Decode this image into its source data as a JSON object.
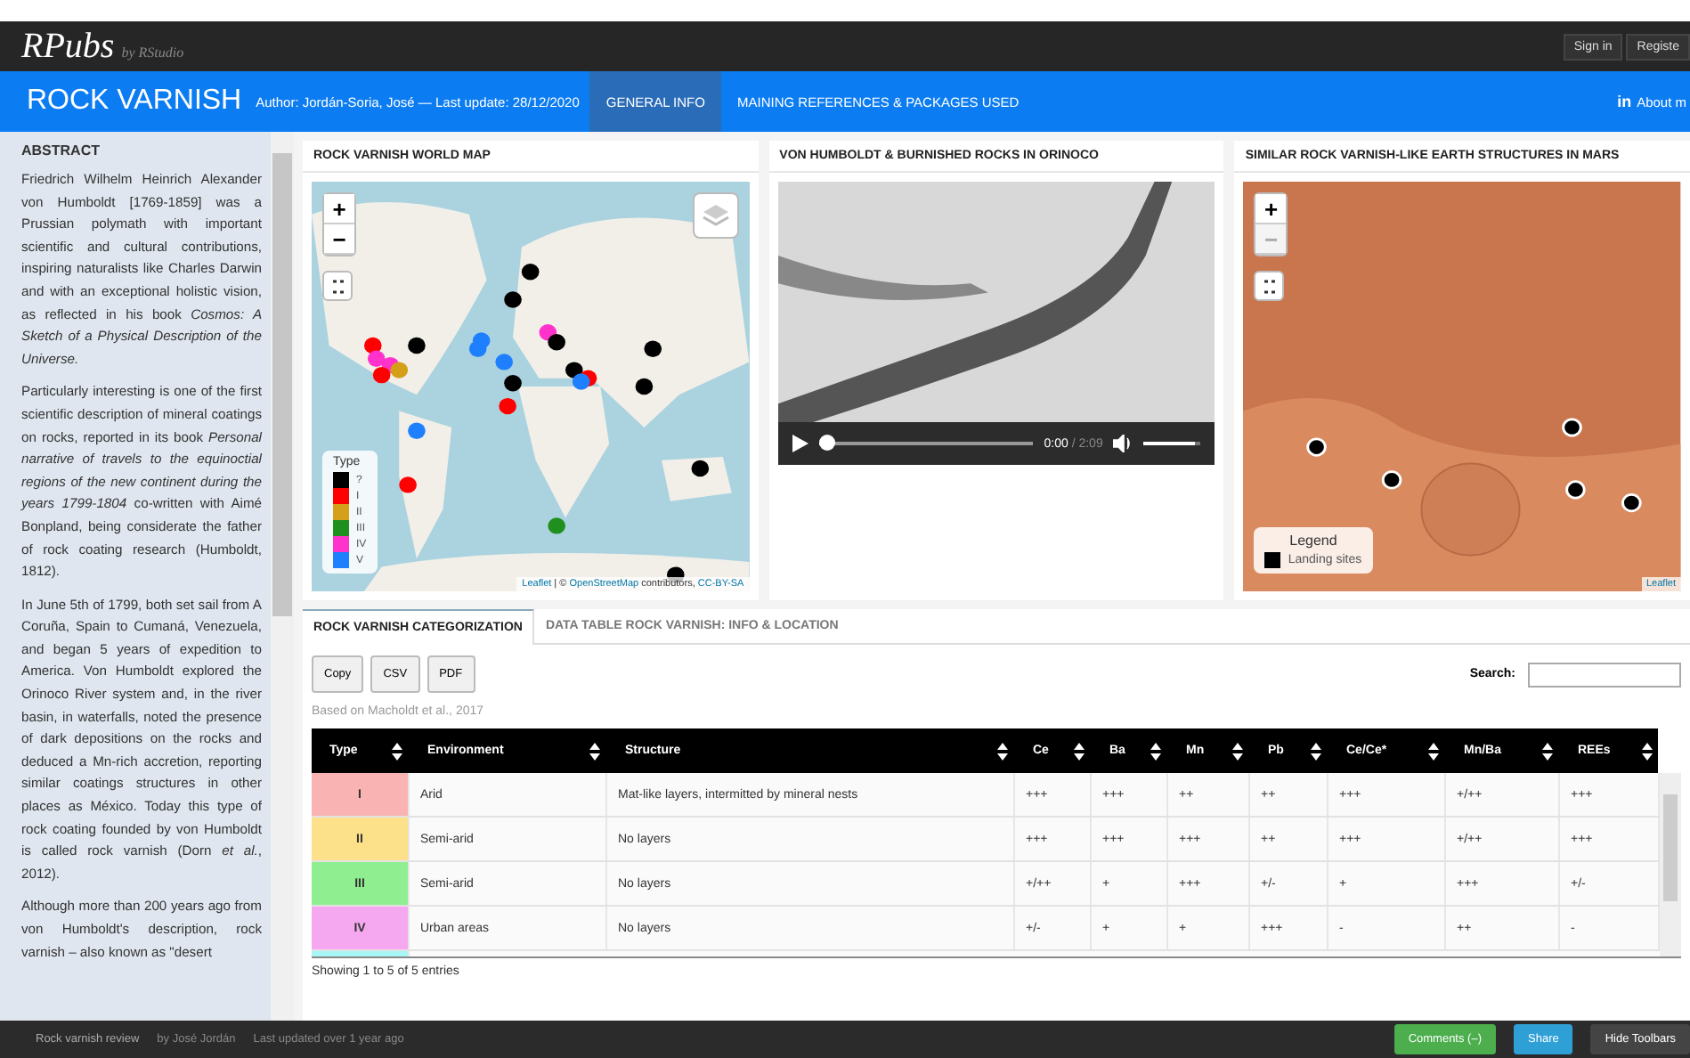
{
  "topbar": {
    "logo_main": "RPubs",
    "logo_sub": "by RStudio",
    "buttons": [
      "Sign in",
      "Registe"
    ]
  },
  "navbar": {
    "title": "ROCK VARNISH",
    "meta": "Author: Jordán-Soria, José — Last update: 28/12/2020",
    "links": [
      {
        "label": "GENERAL INFO",
        "selected": true
      },
      {
        "label": "MAINING REFERENCES & PACKAGES USED",
        "selected": false
      }
    ],
    "right_icon": "in",
    "right_link": "About m"
  },
  "sidebar": {
    "heading": "ABSTRACT",
    "paragraphs": [
      "Friedrich Wilhelm Heinrich Alexander von Humboldt [1769-1859] was a Prussian polymath with important scientific and cultural contributions, inspiring naturalists like Charles Darwin and with an exceptional holistic vision, as reflected in his book *Cosmos: A Sketch of a Physical Description of the Universe.*",
      "Particularly interesting is one of the first scientific description of mineral coatings on rocks, reported in its book *Personal narrative of travels to the equinoctial regions of the new continent during the years 1799-1804* co-written with Aimé Bonpland, being considerate the father of rock coating research (Humboldt, 1812).",
      "In June 5th of 1799, both set sail from A Coruña, Spain to Cumaná, Venezuela, and began 5 years of expedition to America. Von Humboldt explored the Orinoco River system and, in the river basin, in waterfalls, noted the presence of dark depositions on the rocks and deduced a Mn-rich accretion, reporting similar coatings structures in other places as México. Today this type of rock coating founded by von Humboldt is called rock varnish (Dorn *et al.*, 2012).",
      "Although more than 200 years ago from von Humboldt's description, rock varnish – also known as \"desert"
    ]
  },
  "panels": [
    {
      "kind": "worldmap",
      "title": "ROCK VARNISH WORLD MAP",
      "zoom_in": "+",
      "zoom_out": "−",
      "legend_title": "Type",
      "legend": [
        {
          "label": "?",
          "color": "#000000"
        },
        {
          "label": "I",
          "color": "#ff0000"
        },
        {
          "label": "II",
          "color": "#d4a017"
        },
        {
          "label": "III",
          "color": "#1f8f1f"
        },
        {
          "label": "IV",
          "color": "#ff33cc"
        },
        {
          "label": "V",
          "color": "#1e7fff"
        }
      ],
      "attribution": [
        "Leaflet",
        " | © ",
        "OpenStreetMap",
        " contributors, ",
        "CC-BY-SA"
      ]
    },
    {
      "kind": "video",
      "title": "VON HUMBOLDT & BURNISHED ROCKS IN ORINOCO",
      "time": "0:00",
      "duration": "/ 2:09",
      "level": 0.03,
      "volume": {
        "level": 0.9
      }
    },
    {
      "kind": "marsmap",
      "title": "SIMILAR ROCK VARNISH-LIKE EARTH STRUCTURES IN MARS",
      "zoom_in": "+",
      "zoom_out": "−",
      "legend_title": "Legend",
      "legend": [
        {
          "label": "Landing sites",
          "color": "#000000"
        }
      ],
      "attribution": [
        "Leaflet"
      ]
    }
  ],
  "tabs": [
    {
      "label": "ROCK VARNISH CATEGORIZATION",
      "selected": true
    },
    {
      "label": "DATA TABLE ROCK VARNISH: INFO & LOCATION",
      "selected": false
    }
  ],
  "export_buttons": [
    "Copy",
    "CSV",
    "PDF"
  ],
  "search_label": "Search:",
  "caption": "Based on Macholdt et al., 2017",
  "table": {
    "columns": [
      "Type",
      "Environment",
      "Structure",
      "Ce",
      "Ba",
      "Mn",
      "Pb",
      "Ce/Ce*",
      "Mn/Ba",
      "REEs"
    ],
    "rows": [
      {
        "color": "#f9b3b3",
        "cells": [
          "I",
          "Arid",
          "Mat-like layers, intermitted by mineral nests",
          "+++",
          "+++",
          "++",
          "++",
          "+++",
          "+/++",
          "+++"
        ]
      },
      {
        "color": "#fde08a",
        "cells": [
          "II",
          "Semi-arid",
          "No layers",
          "+++",
          "+++",
          "+++",
          "++",
          "+++",
          "+/++",
          "+++"
        ]
      },
      {
        "color": "#8fee8f",
        "cells": [
          "III",
          "Semi-arid",
          "No layers",
          "+/++",
          "+",
          "+++",
          "+/-",
          "+",
          "+++",
          "+/-"
        ]
      },
      {
        "color": "#f5a8f0",
        "cells": [
          "IV",
          "Urban areas",
          "No layers",
          "+/-",
          "+",
          "+",
          "+++",
          "-",
          "++",
          "-"
        ]
      },
      {
        "color": "#a8f5f5",
        "cells": []
      }
    ],
    "info": "Showing 1 to 5 of 5 entries"
  },
  "footer": {
    "left": [
      "Rock varnish review",
      "by José Jordán",
      "Last updated over 1 year ago"
    ],
    "buttons": [
      {
        "kind": "comments",
        "label": "Comments (–)"
      },
      {
        "kind": "share",
        "label": "Share"
      },
      {
        "kind": "plain",
        "label": "Hide Toolbars"
      }
    ]
  }
}
